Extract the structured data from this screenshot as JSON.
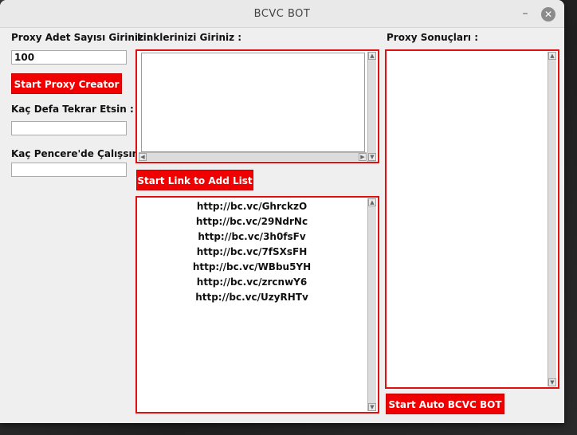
{
  "window": {
    "title": "BCVC BOT",
    "minimize_glyph": "–",
    "close_glyph": "✕"
  },
  "left": {
    "proxy_count_label": "Proxy Adet Sayısı Giriniz :",
    "proxy_count_value": "100",
    "start_proxy_button": "Start Proxy Creator",
    "repeat_label": "Kaç Defa Tekrar Etsin :",
    "repeat_value": "",
    "windows_label": "Kaç Pencere'de Çalışsın :",
    "windows_value": ""
  },
  "middle": {
    "links_label": "Linklerinizi Giriniz :",
    "links_input_value": "",
    "add_list_button": "Start Link to Add List",
    "link_list": [
      "http://bc.vc/GhrckzO",
      "http://bc.vc/29NdrNc",
      "http://bc.vc/3h0fsFv",
      "http://bc.vc/7fSXsFH",
      "http://bc.vc/WBbu5YH",
      "http://bc.vc/zrcnwY6",
      "http://bc.vc/UzyRHTv"
    ]
  },
  "right": {
    "results_label": "Proxy Sonuçları :",
    "auto_bot_button": "Start Auto BCVC BOT"
  },
  "icons": {
    "scroll_up": "▲",
    "scroll_down": "▼",
    "scroll_left": "◀",
    "scroll_right": "▶"
  },
  "colors": {
    "accent_red": "#f00000",
    "frame_red": "#e01010"
  }
}
